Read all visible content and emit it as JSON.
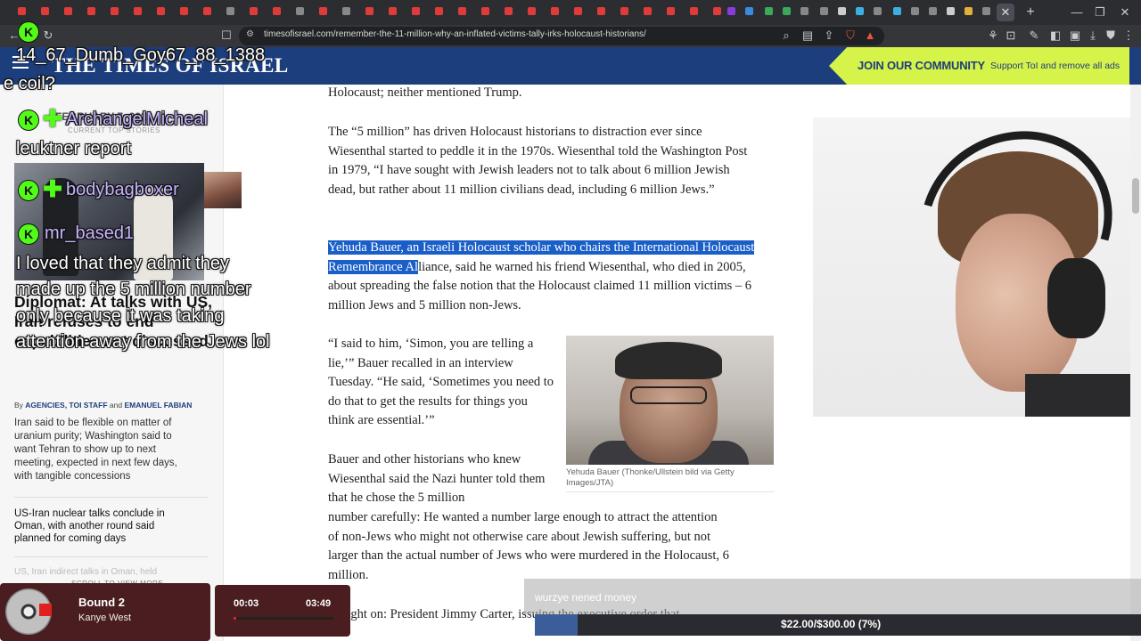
{
  "browser": {
    "url": "timesofisrael.com/remember-the-11-million-why-an-inflated-victims-tally-irks-holocaust-historians/",
    "close_tab": "✕",
    "new_tab": "+"
  },
  "site": {
    "logo": "THE TIMES OF ISRAEL",
    "join_title": "JOIN OUR COMMUNITY",
    "join_sub": "Support ToI and remove all ads"
  },
  "sidebar": {
    "date": "FEBRUARY 7, 2026",
    "current_label": "CURRENT TOP STORIES",
    "headline": "Diplomat: At talks with US, Iran refuses to end capabilities not discussed",
    "byline_prefix": "By",
    "byline_authors1": "AGENCIES, TOI STAFF",
    "byline_and": "and",
    "byline_authors2": "EMANUEL FABIAN",
    "summary": "Iran said to be flexible on matter of uranium purity; Washington said to want Tehran to show up to next meeting, expected in next few days, with tangible concessions",
    "story2": "US-Iran nuclear talks conclude in Oman, with another round said planned for coming days",
    "story3": "US, Iran indirect talks in Oman, held",
    "scroll_label": "SCROLL TO VIEW MORE"
  },
  "chat": {
    "msg1_text": "14_67_Dumb_Goy67_88_1388",
    "msg1_cont": "e coil?",
    "user2": "ArchangelMicheal",
    "msg2_text": "leuktner report",
    "user3": "bodybagboxer",
    "user4": "mr_based1",
    "msg4_text_1": "I loved that they admit they",
    "msg4_text_2": "made up the 5 million number",
    "msg4_text_3": "only because it was taking",
    "msg4_text_4": "attention away from the Jews lol",
    "badge": "K"
  },
  "article": {
    "p0": "Holocaust; neither mentioned Trump.",
    "p1": "The “5 million” has driven Holocaust historians to distraction ever since Wiesenthal started to peddle it in the 1970s. Wiesenthal told the Washington Post in 1979, “I have sought with Jewish leaders not to talk about 6 million Jewish dead, but rather about 11 million civilians dead, including 6 million Jews.”",
    "p2_highlight": "Yehuda Bauer, an Israeli Holocaust scholar who chairs the International Holocaust Remembrance Al",
    "p2_rest": "liance, said he warned his friend Wiesenthal, who died in 2005, about spreading the false notion that the Holocaust claimed 11 million victims – 6 million Jews and 5 million non-Jews.",
    "p3": "“I said to him, ‘Simon, you are telling a lie,’” Bauer recalled in an interview Tuesday. “He said, ‘Sometimes you need to do that to get the results for things you think are essential.’”",
    "p4a": "Bauer and other historians who knew Wiesenthal said the Nazi hunter told them that he chose the 5 million",
    "p4b": "number carefully: He wanted a number large enough to attract the attention of non-Jews who might not otherwise care about Jewish suffering, but not larger than the actual number of Jews who were murdered in the Holocaust, 6 million.",
    "p5": "...ought on: President Jimmy Carter, issuing the executive order that",
    "image_caption": "Yehuda Bauer (Thonke/Ullstein bild via Getty Images/JTA)"
  },
  "music": {
    "song": "Bound 2",
    "artist": "Kanye West",
    "current_time": "00:03",
    "total_time": "03:49",
    "progress": 0.013
  },
  "donation": {
    "message": "wurzye nened money",
    "goal_text": "$22.00/$300.00 (7%)",
    "goal_fraction": 0.07
  },
  "colors": {
    "header_bg": "#1d3e7c",
    "join_bg": "#d6f34a",
    "highlight": "#1a5fc8",
    "kick_green": "#53fc18"
  }
}
